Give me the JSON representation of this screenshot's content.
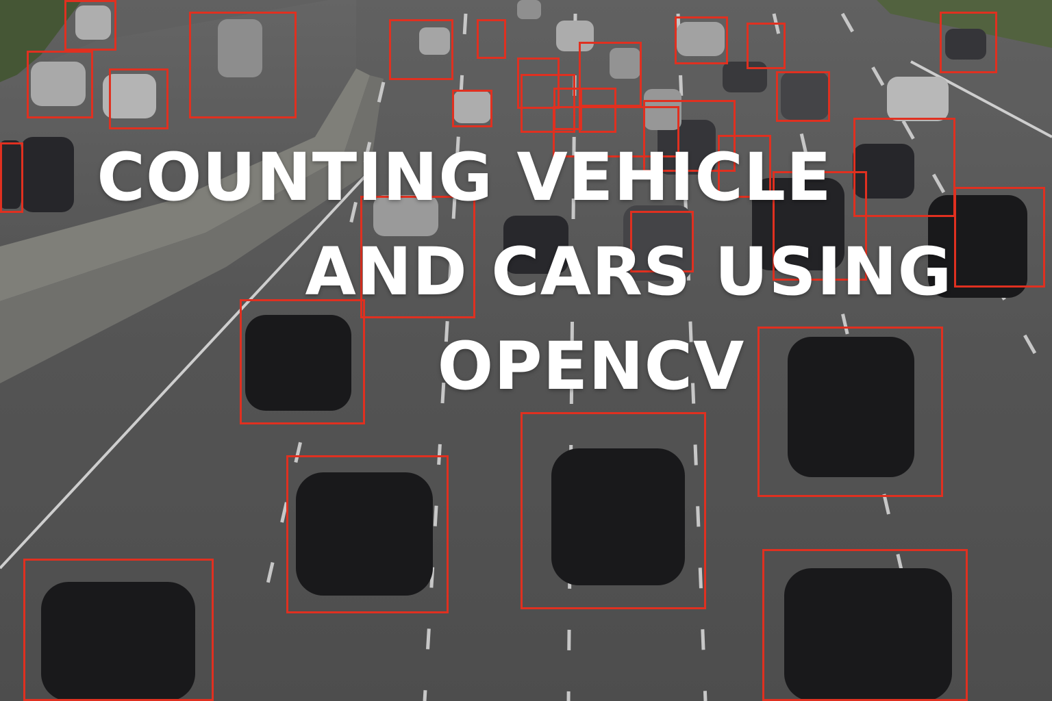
{
  "headline": {
    "line1": "COUNTING VEHICLE",
    "line2": "AND CARS USING",
    "line3": "OPENCV"
  },
  "colors": {
    "detection_box": "#e03020",
    "headline_text": "#ffffff",
    "road": "#585858",
    "car_dark": "#1c1c1e",
    "car_light": "#b8b8b8"
  }
}
